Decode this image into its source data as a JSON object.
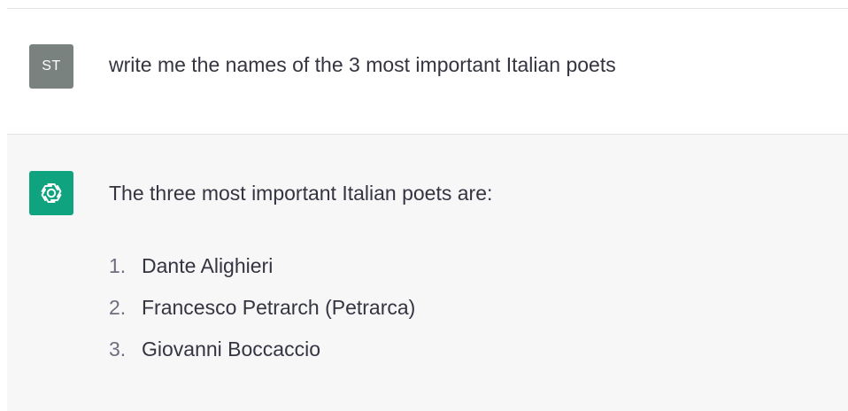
{
  "conversation": {
    "user": {
      "avatar_initials": "ST",
      "message": "write me the names of the 3 most important Italian poets"
    },
    "assistant": {
      "avatar_icon": "openai-logo-icon",
      "intro": "The three most important Italian poets are:",
      "list": [
        {
          "number": "1.",
          "text": "Dante Alighieri"
        },
        {
          "number": "2.",
          "text": "Francesco Petrarch (Petrarca)"
        },
        {
          "number": "3.",
          "text": "Giovanni Boccaccio"
        }
      ]
    }
  },
  "colors": {
    "user_avatar_bg": "#7a827f",
    "assistant_avatar_bg": "#10a37f",
    "assistant_row_bg": "#f7f7f8",
    "text": "#343541",
    "list_number": "#6e6e80"
  }
}
